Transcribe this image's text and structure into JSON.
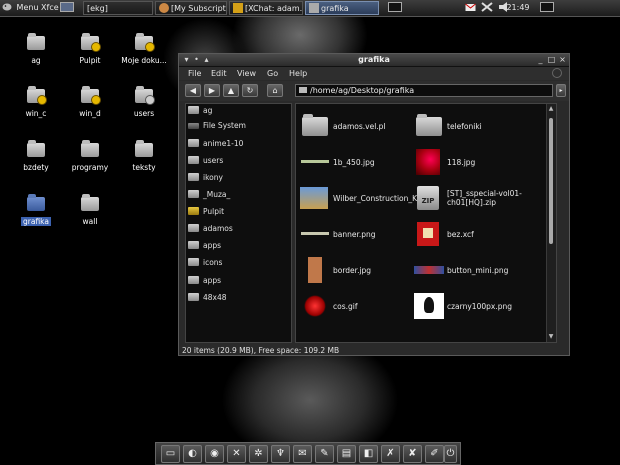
{
  "top_panel": {
    "menu_label": "Menu Xfce",
    "tasks": [
      {
        "label": "[ekg]"
      },
      {
        "label": "[My Subscripti..."
      },
      {
        "label": "[XChat: adam..."
      },
      {
        "label": "grafika"
      }
    ],
    "clock": "21:49"
  },
  "desktop_icons": [
    {
      "label": "ag"
    },
    {
      "label": "Pulpit"
    },
    {
      "label": "Moje doku..."
    },
    {
      "label": "win_c"
    },
    {
      "label": "win_d"
    },
    {
      "label": "users"
    },
    {
      "label": "bzdety"
    },
    {
      "label": "programy"
    },
    {
      "label": "teksty"
    },
    {
      "label": "grafika"
    },
    {
      "label": "wall"
    }
  ],
  "window": {
    "title": "grafika",
    "menu": [
      "File",
      "Edit",
      "View",
      "Go",
      "Help"
    ],
    "path": "/home/ag/Desktop/grafika",
    "sidebar": [
      {
        "label": "ag",
        "icon": "home-folder-icon"
      },
      {
        "label": "File System",
        "icon": "drive-icon"
      },
      {
        "label": "anime1-10",
        "icon": "folder-icon"
      },
      {
        "label": "users",
        "icon": "folder-icon"
      },
      {
        "label": "ikony",
        "icon": "folder-icon"
      },
      {
        "label": "_Muza_",
        "icon": "folder-icon"
      },
      {
        "label": "Pulpit",
        "icon": "desktop-folder-icon"
      },
      {
        "label": "adamos",
        "icon": "folder-icon"
      },
      {
        "label": "apps",
        "icon": "folder-icon"
      },
      {
        "label": "icons",
        "icon": "folder-icon"
      },
      {
        "label": "apps",
        "icon": "folder-icon"
      },
      {
        "label": "48x48",
        "icon": "folder-icon"
      }
    ],
    "files": [
      {
        "name": "adamos.vel.pl",
        "kind": "folder"
      },
      {
        "name": "telefoniki",
        "kind": "folder"
      },
      {
        "name": "1b_450.jpg",
        "kind": "thin-image"
      },
      {
        "name": "118.jpg",
        "kind": "red-image"
      },
      {
        "name": "Wilber_Construction_Kit.xcf",
        "kind": "xcf"
      },
      {
        "name": "[ST]_sspecial-vol01-ch01[HQ].zip",
        "kind": "zip"
      },
      {
        "name": "banner.png",
        "kind": "thin-image"
      },
      {
        "name": "bez.xcf",
        "kind": "red-image"
      },
      {
        "name": "border.jpg",
        "kind": "brown-image"
      },
      {
        "name": "button_mini.png",
        "kind": "small-image"
      },
      {
        "name": "cos.gif",
        "kind": "red-image"
      },
      {
        "name": "czarny100px.png",
        "kind": "bird-image"
      }
    ],
    "status": "20 items (20.9 MB), Free space: 109.2 MB"
  }
}
